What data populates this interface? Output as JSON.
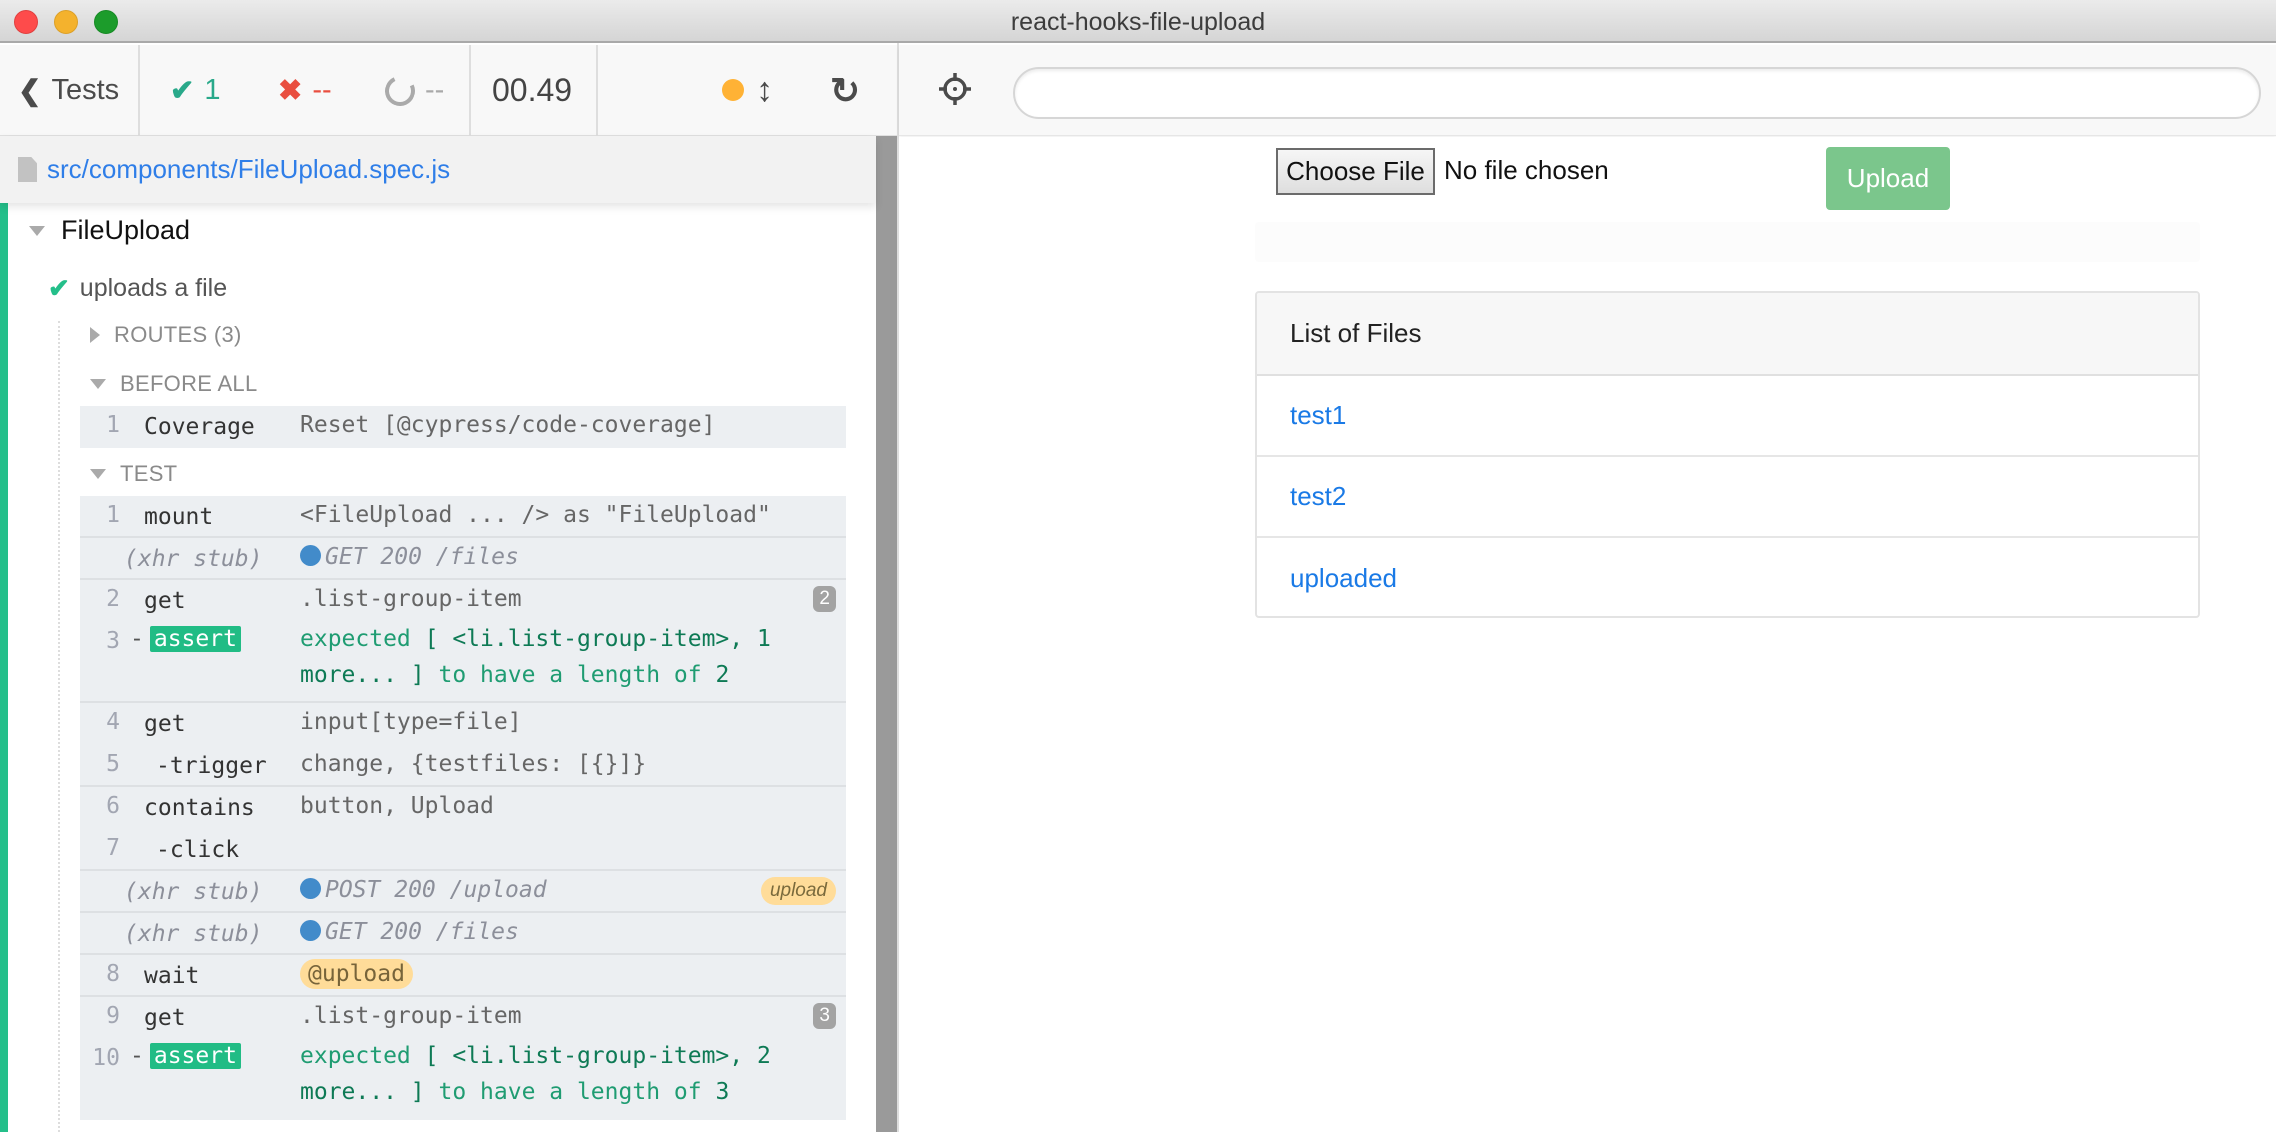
{
  "window": {
    "title": "react-hooks-file-upload"
  },
  "reporter": {
    "tests_label": "Tests",
    "stats": {
      "passed": "1",
      "failed": "--",
      "pending": "--"
    },
    "duration": "00.49",
    "colors": {
      "passed": "#29a98a",
      "failed": "#e94e3f",
      "pending": "#a9a9a9",
      "auto_scroll_dot": "#ffb235"
    },
    "spec_path": "src/components/FileUpload.spec.js",
    "suite": {
      "title": "FileUpload",
      "test": {
        "title": "uploads a file",
        "state": "passed",
        "routes_label": "ROUTES (3)",
        "hooks": [
          {
            "label": "BEFORE ALL",
            "commands": [
              {
                "num": "1",
                "name": "Coverage",
                "message": "Reset [@cypress/code-coverage]"
              }
            ]
          },
          {
            "label": "TEST",
            "commands": [
              {
                "num": "1",
                "name": "mount",
                "message": "<FileUpload ... /> as \"FileUpload\""
              },
              {
                "num": "",
                "name": "(xhr stub)",
                "message": "GET 200 /files",
                "type": "xhr"
              },
              {
                "num": "2",
                "name": "get",
                "message": ".list-group-item",
                "count": "2"
              },
              {
                "num": "3",
                "name": "assert",
                "child": true,
                "message_line1_a": "expected",
                "message_line1_b": "[ <li.list-group-item>, 1",
                "message_line2_a": "more... ]",
                "message_line2_b": "to have a length of",
                "message_line2_c": "2"
              },
              {
                "num": "4",
                "name": "get",
                "message": "input[type=file]"
              },
              {
                "num": "5",
                "name": "-trigger",
                "message": "change, {testfiles: [{}]}"
              },
              {
                "num": "6",
                "name": "contains",
                "message": "button, Upload"
              },
              {
                "num": "7",
                "name": "-click",
                "message": ""
              },
              {
                "num": "",
                "name": "(xhr stub)",
                "message": "POST 200 /upload",
                "type": "xhr",
                "alias": "upload"
              },
              {
                "num": "",
                "name": "(xhr stub)",
                "message": "GET 200 /files",
                "type": "xhr"
              },
              {
                "num": "8",
                "name": "wait",
                "message": "@upload"
              },
              {
                "num": "9",
                "name": "get",
                "message": ".list-group-item",
                "count": "3"
              },
              {
                "num": "10",
                "name": "assert",
                "child": true,
                "message_line1_a": "expected",
                "message_line1_b": "[ <li.list-group-item>, 2",
                "message_line2_a": "more... ]",
                "message_line2_b": "to have a length of",
                "message_line2_c": "3"
              }
            ]
          }
        ]
      }
    }
  },
  "aut": {
    "url": "",
    "choose_file_label": "Choose File",
    "no_file_label": "No file chosen",
    "upload_label": "Upload",
    "upload_color": "#7bc68c",
    "card_title": "List of Files",
    "files": [
      "test1",
      "test2",
      "uploaded"
    ]
  }
}
